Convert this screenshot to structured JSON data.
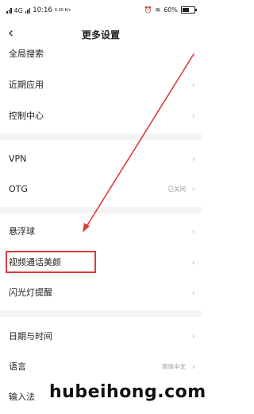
{
  "status_bar": {
    "signal1": "4G",
    "time": "10:16",
    "speed": "0.00 K/s",
    "battery": "60%",
    "battery_level": 0.6
  },
  "header": {
    "title": "更多设置"
  },
  "settings": {
    "group1": [
      {
        "label": "全局搜索"
      },
      {
        "label": "近期应用"
      },
      {
        "label": "控制中心"
      }
    ],
    "group2": [
      {
        "label": "VPN",
        "value": ""
      },
      {
        "label": "OTG",
        "value": "已关闭"
      }
    ],
    "group3": [
      {
        "label": "悬浮球"
      },
      {
        "label": "视频通话美颜"
      },
      {
        "label": "闪光灯提醒"
      }
    ],
    "group4": [
      {
        "label": "日期与时间",
        "value": ""
      },
      {
        "label": "语言",
        "value": "简体中文"
      },
      {
        "label": "输入法",
        "value": ""
      }
    ]
  },
  "watermark": "hubeihong.com",
  "colors": {
    "annotation": "#e03a3a"
  }
}
